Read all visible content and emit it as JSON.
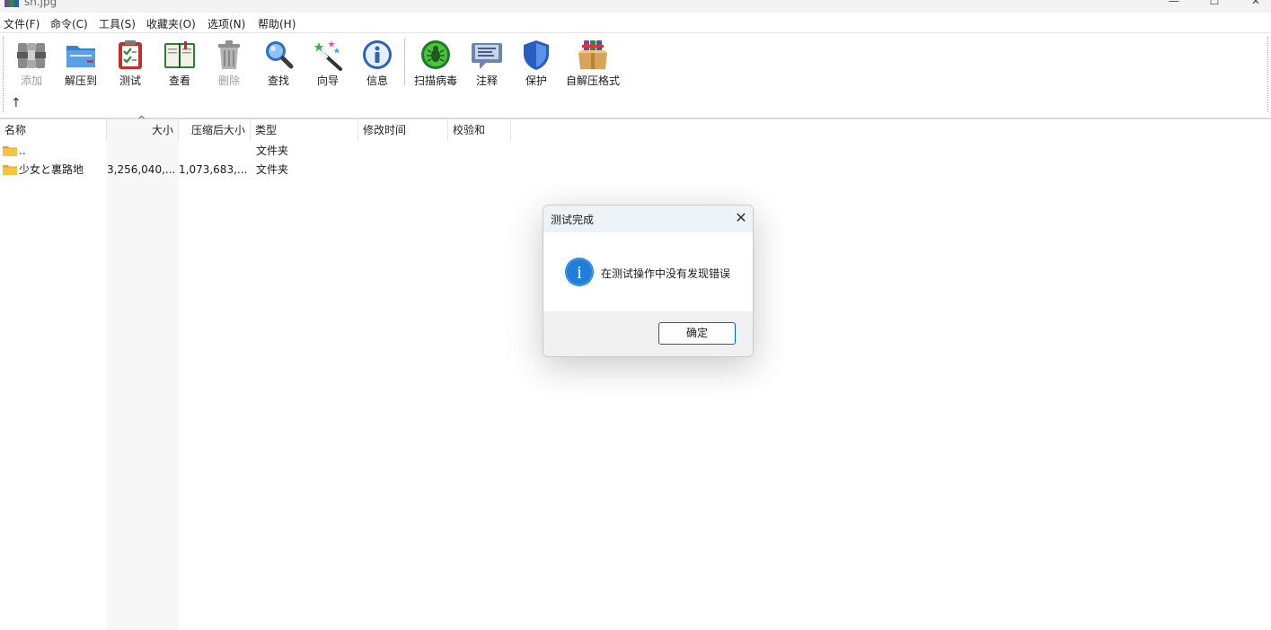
{
  "window": {
    "title": "sh.jpg",
    "controls": {
      "minimize": "—",
      "maximize": "☐",
      "close": "✕"
    }
  },
  "menu": [
    "文件(F)",
    "命令(C)",
    "工具(S)",
    "收藏夹(O)",
    "选项(N)",
    "帮助(H)"
  ],
  "toolbar": {
    "buttons": [
      {
        "label": "添加",
        "icon": "archive-add-icon",
        "enabled": false
      },
      {
        "label": "解压到",
        "icon": "folder-extract-icon",
        "enabled": true
      },
      {
        "label": "测试",
        "icon": "clipboard-check-icon",
        "enabled": true
      },
      {
        "label": "查看",
        "icon": "book-view-icon",
        "enabled": true
      },
      {
        "label": "删除",
        "icon": "trash-icon",
        "enabled": false
      },
      {
        "label": "查找",
        "icon": "magnifier-icon",
        "enabled": true
      },
      {
        "label": "向导",
        "icon": "wizard-wand-icon",
        "enabled": true
      },
      {
        "label": "信息",
        "icon": "info-icon",
        "enabled": true
      },
      {
        "label": "扫描病毒",
        "icon": "virus-scan-icon",
        "enabled": true
      },
      {
        "label": "注释",
        "icon": "comment-icon",
        "enabled": true
      },
      {
        "label": "保护",
        "icon": "shield-icon",
        "enabled": true
      },
      {
        "label": "自解压格式",
        "icon": "sfx-box-icon",
        "enabled": true
      }
    ],
    "up_arrow": "↑"
  },
  "list": {
    "columns": [
      "名称",
      "大小",
      "压缩后大小",
      "类型",
      "修改时间",
      "校验和"
    ],
    "sort_indicator": "^",
    "rows": [
      {
        "name": "..",
        "size": "",
        "packed": "",
        "type": "文件夹",
        "modified": "",
        "crc": ""
      },
      {
        "name": "少女と裏路地",
        "size": "3,256,040,...",
        "packed": "1,073,683,...",
        "type": "文件夹",
        "modified": "",
        "crc": ""
      }
    ]
  },
  "dialog": {
    "title": "测试完成",
    "message": "在测试操作中没有发现错误",
    "ok_label": "确定",
    "close_glyph": "✕",
    "info_glyph": "i"
  },
  "colors": {
    "accent": "#0067c0",
    "info_blue": "#1f7fd6",
    "folder_yellow": "#f4c542"
  }
}
